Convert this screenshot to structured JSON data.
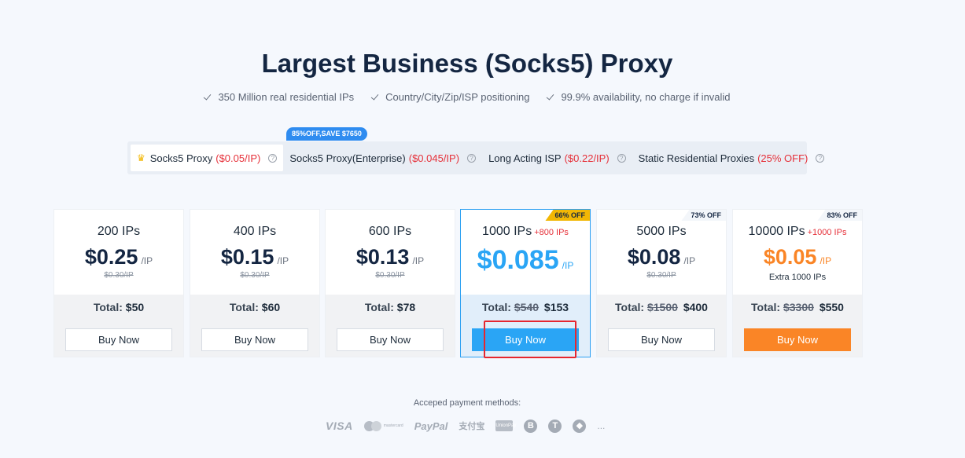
{
  "header": {
    "title": "Largest Business (Socks5) Proxy",
    "features": [
      "350 Million real residential IPs",
      "Country/City/Zip/ISP positioning",
      "99.9% availability, no charge if invalid"
    ]
  },
  "promo_badge": "85%OFF,SAVE $7650",
  "tabs": [
    {
      "name": "Socks5 Proxy",
      "price": "($0.05/IP)",
      "active": true
    },
    {
      "name": "Socks5 Proxy(Enterprise)",
      "price": "($0.045/IP)",
      "active": false
    },
    {
      "name": "Long Acting ISP",
      "price": "($0.22/IP)",
      "active": false
    },
    {
      "name": "Static Residential Proxies",
      "price": "(25% OFF)",
      "active": false
    }
  ],
  "tab_help_glyph": "?",
  "crown_glyph": "♛",
  "plans": [
    {
      "ips": "200 IPs",
      "bonus": "",
      "price": "$0.25",
      "unit": "/IP",
      "old_price": "$0.30/IP",
      "extra": "",
      "total_label": "Total:",
      "total_old": "",
      "total": "$50",
      "buy": "Buy Now",
      "corner": ""
    },
    {
      "ips": "400 IPs",
      "bonus": "",
      "price": "$0.15",
      "unit": "/IP",
      "old_price": "$0.30/IP",
      "extra": "",
      "total_label": "Total:",
      "total_old": "",
      "total": "$60",
      "buy": "Buy Now",
      "corner": ""
    },
    {
      "ips": "600 IPs",
      "bonus": "",
      "price": "$0.13",
      "unit": "/IP",
      "old_price": "$0.30/IP",
      "extra": "",
      "total_label": "Total:",
      "total_old": "",
      "total": "$78",
      "buy": "Buy Now",
      "corner": ""
    },
    {
      "ips": "1000 IPs",
      "bonus": "+800 IPs",
      "price": "$0.085",
      "unit": "/IP",
      "old_price": "",
      "extra": "",
      "total_label": "Total:",
      "total_old": "$540",
      "total": "$153",
      "buy": "Buy Now",
      "corner": "66% OFF"
    },
    {
      "ips": "5000 IPs",
      "bonus": "",
      "price": "$0.08",
      "unit": "/IP",
      "old_price": "$0.30/IP",
      "extra": "",
      "total_label": "Total:",
      "total_old": "$1500",
      "total": "$400",
      "buy": "Buy Now",
      "corner": "73% OFF"
    },
    {
      "ips": "10000 IPs",
      "bonus": "+1000 IPs",
      "price": "$0.05",
      "unit": "/IP",
      "old_price": "",
      "extra": "Extra 1000 IPs",
      "total_label": "Total:",
      "total_old": "$3300",
      "total": "$550",
      "buy": "Buy Now",
      "corner": "83% OFF"
    }
  ],
  "payment": {
    "title": "Acceped payment methods:",
    "visa": "VISA",
    "mastercard": "mastercard",
    "paypal": "PayPal",
    "alipay": "支付宝",
    "unionpay": "UnionPay",
    "bitcoin": "B",
    "tether": "T",
    "ethereum": "◆",
    "more": "..."
  },
  "colors": {
    "accent_blue": "#2aa5f5",
    "accent_orange": "#fa8526",
    "price_red": "#e6313a",
    "highlight_box": "#e6262f"
  }
}
